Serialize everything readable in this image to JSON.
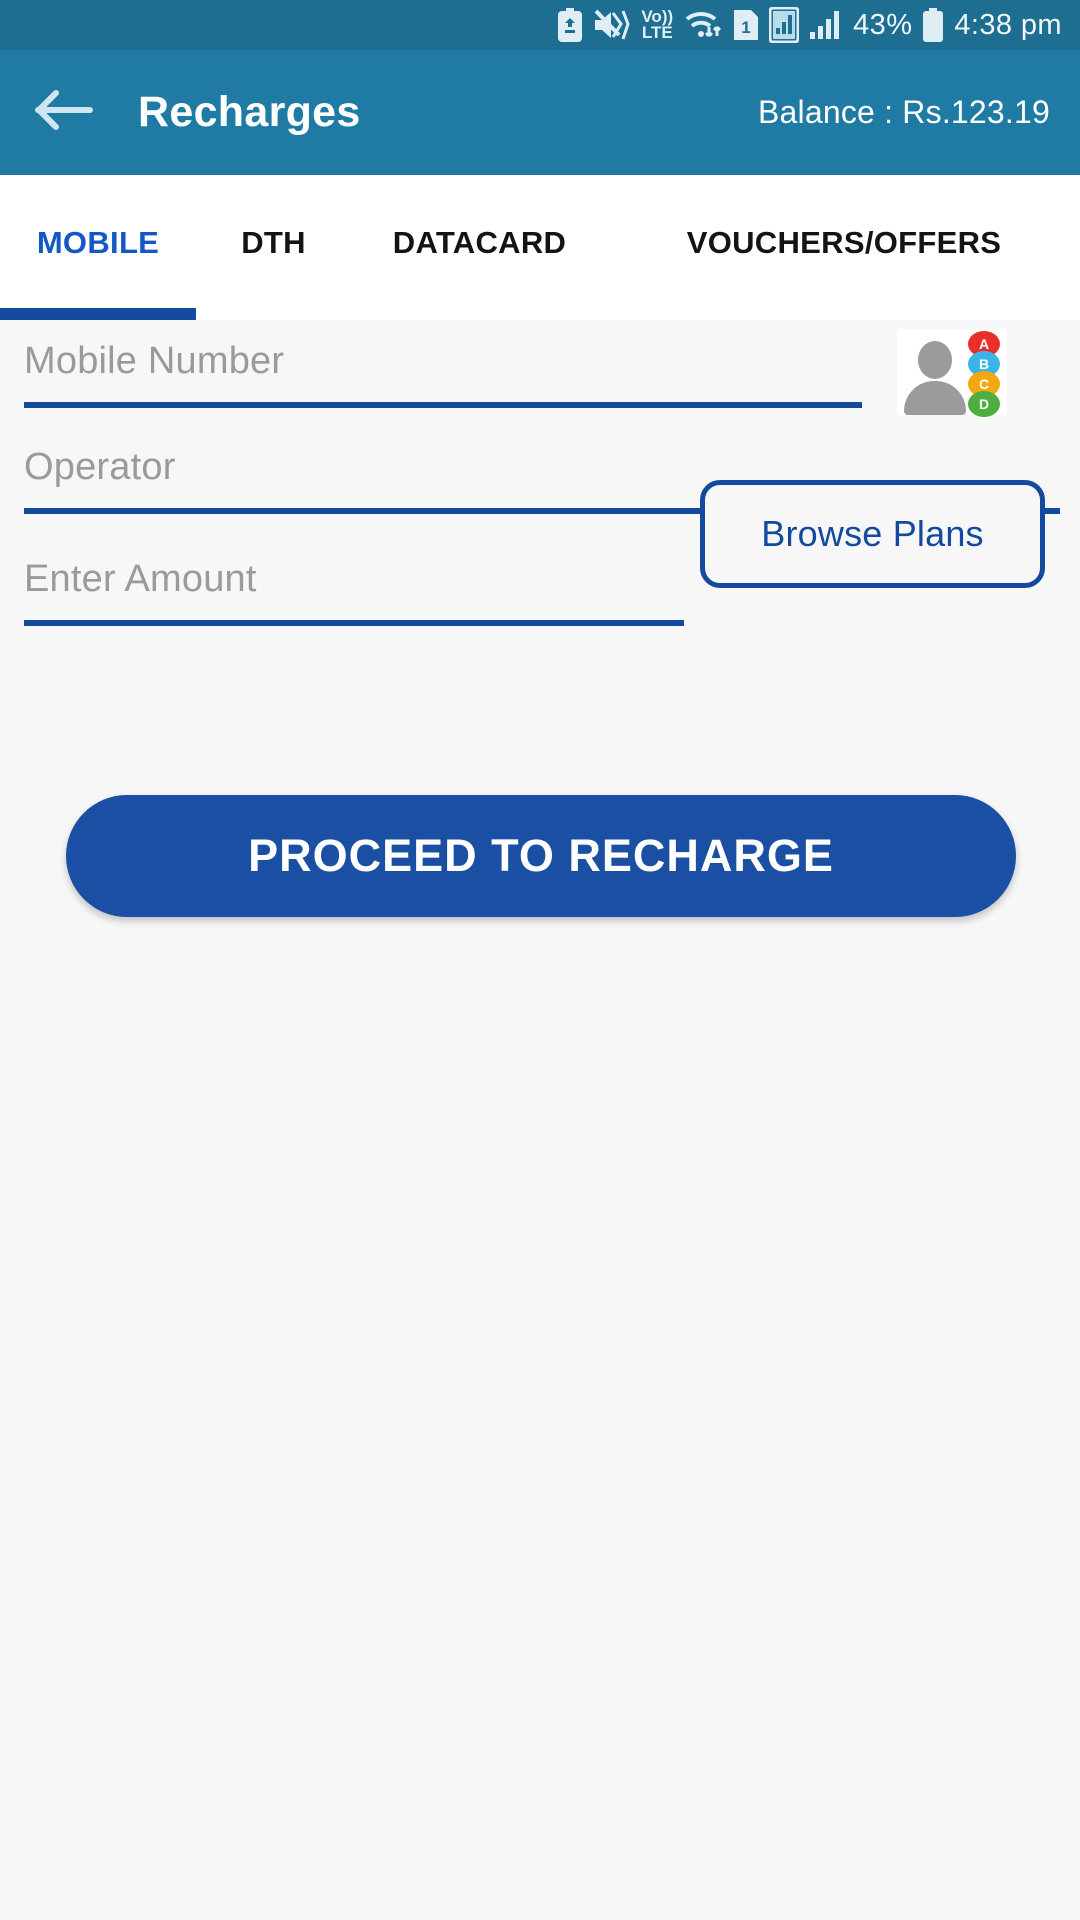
{
  "statusbar": {
    "icons": [
      "battery-saver-icon",
      "mute-vibrate-icon",
      "volte-icon",
      "wifi-data-icon",
      "sim1-icon",
      "signal-sim-icon",
      "signal-bars-icon"
    ],
    "volte_top": "Vo))",
    "volte_bottom": "LTE",
    "sim_number": "1",
    "battery_percent": "43%",
    "time": "4:38 pm"
  },
  "appbar": {
    "back_icon": "arrow-left-icon",
    "title": "Recharges",
    "balance": "Balance : Rs.123.19",
    "background_color": "#1f7ba3"
  },
  "tabs": {
    "items": [
      {
        "label": "MOBILE",
        "active": true
      },
      {
        "label": "DTH",
        "active": false
      },
      {
        "label": "DATACARD",
        "active": false
      },
      {
        "label": "VOUCHERS/OFFERS",
        "active": false
      }
    ],
    "active_color": "#1358c4",
    "indicator_color": "#134a9e"
  },
  "form": {
    "mobile_number": {
      "placeholder": "Mobile Number",
      "value": ""
    },
    "contacts_picker": {
      "icon": "contacts-icon",
      "letters": [
        {
          "label": "A",
          "color": "#e8302a"
        },
        {
          "label": "B",
          "color": "#3ab5e8"
        },
        {
          "label": "C",
          "color": "#f3a712"
        },
        {
          "label": "D",
          "color": "#4caf3f"
        }
      ]
    },
    "operator": {
      "placeholder": "Operator",
      "value": ""
    },
    "amount": {
      "placeholder": "Enter Amount",
      "value": ""
    },
    "browse_plans_label": "Browse Plans",
    "proceed_label": "PROCEED TO RECHARGE",
    "accent_color": "#134a9e"
  }
}
